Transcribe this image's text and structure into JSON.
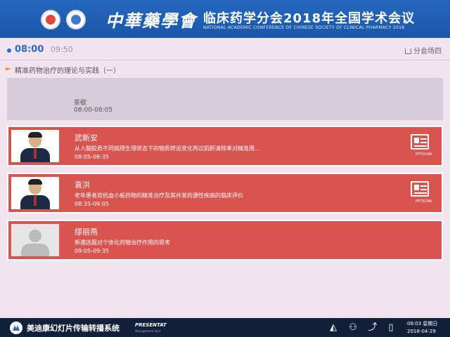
{
  "header": {
    "brand": "中華藥學會",
    "title": "临床药学分会2018年全国学术会议",
    "subtitle": "NATIONAL ACADEMIC CONFERENCE OF CHINESE SOCIETY OF CLINICAL PHARMACY 2018"
  },
  "timebar": {
    "active_time": "08:00",
    "next_time": "09:50",
    "venue": "分会场四"
  },
  "session": {
    "title": "精准药物治疗的理论与实践（一）"
  },
  "break_item": {
    "name": "茶歇",
    "time": "08:00-08:05"
  },
  "speakers": [
    {
      "name": "武新安",
      "topic": "从人脑胶质不同病理生理状态下的物质转运变化再议肌酐清除率对精准用...",
      "time": "08:05-08:35",
      "ppt_label": "PPTSCAN"
    },
    {
      "name": "袁洪",
      "topic": "老年患者双抗血小板药物的精准治疗及其并发药源性疾病的临床评价",
      "time": "08:35-09:05",
      "ppt_label": "PPTSCAN"
    },
    {
      "name": "缪丽燕",
      "topic": "新遴选面对个体化药物治疗作用的思考",
      "time": "09:05-09:35"
    }
  ],
  "taskbar": {
    "app_title": "美迪康幻灯片传输转播系统",
    "brand": "PRESENTAT",
    "brand_sub": "Management Syst",
    "clock": "08:03 星期日",
    "date": "2018-04-29"
  },
  "colors": {
    "header_blue": "#1f5fb4",
    "card_red": "#d9534f",
    "active_blue": "#2a6cc4",
    "page_bg": "#f2e4ef"
  }
}
